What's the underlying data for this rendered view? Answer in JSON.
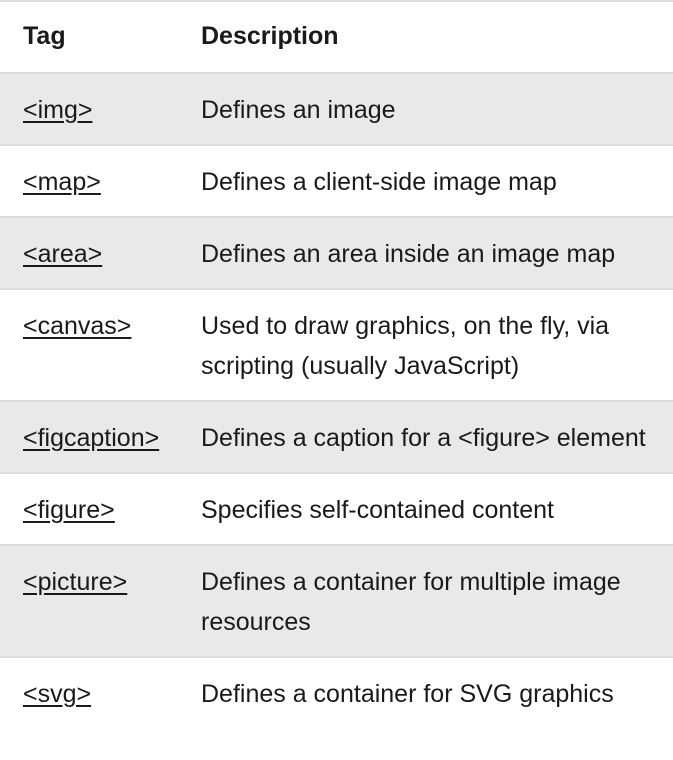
{
  "table": {
    "headers": {
      "tag": "Tag",
      "description": "Description"
    },
    "rows": [
      {
        "tag": "<img>",
        "description": "Defines an image"
      },
      {
        "tag": "<map>",
        "description": "Defines a client-side image map"
      },
      {
        "tag": "<area>",
        "description": "Defines an area inside an image map"
      },
      {
        "tag": "<canvas>",
        "description": "Used to draw graphics, on the fly, via scripting (usually JavaScript)"
      },
      {
        "tag": "<figcaption>",
        "description": "Defines a caption for a <figure> element"
      },
      {
        "tag": "<figure>",
        "description": "Specifies self-contained content"
      },
      {
        "tag": "<picture>",
        "description": "Defines a container for multiple image resources"
      },
      {
        "tag": "<svg>",
        "description": "Defines a container for SVG graphics"
      }
    ]
  },
  "colors": {
    "stripe": "#e9e9e9",
    "border": "#dcdcdc",
    "text": "#1a1a1a"
  }
}
